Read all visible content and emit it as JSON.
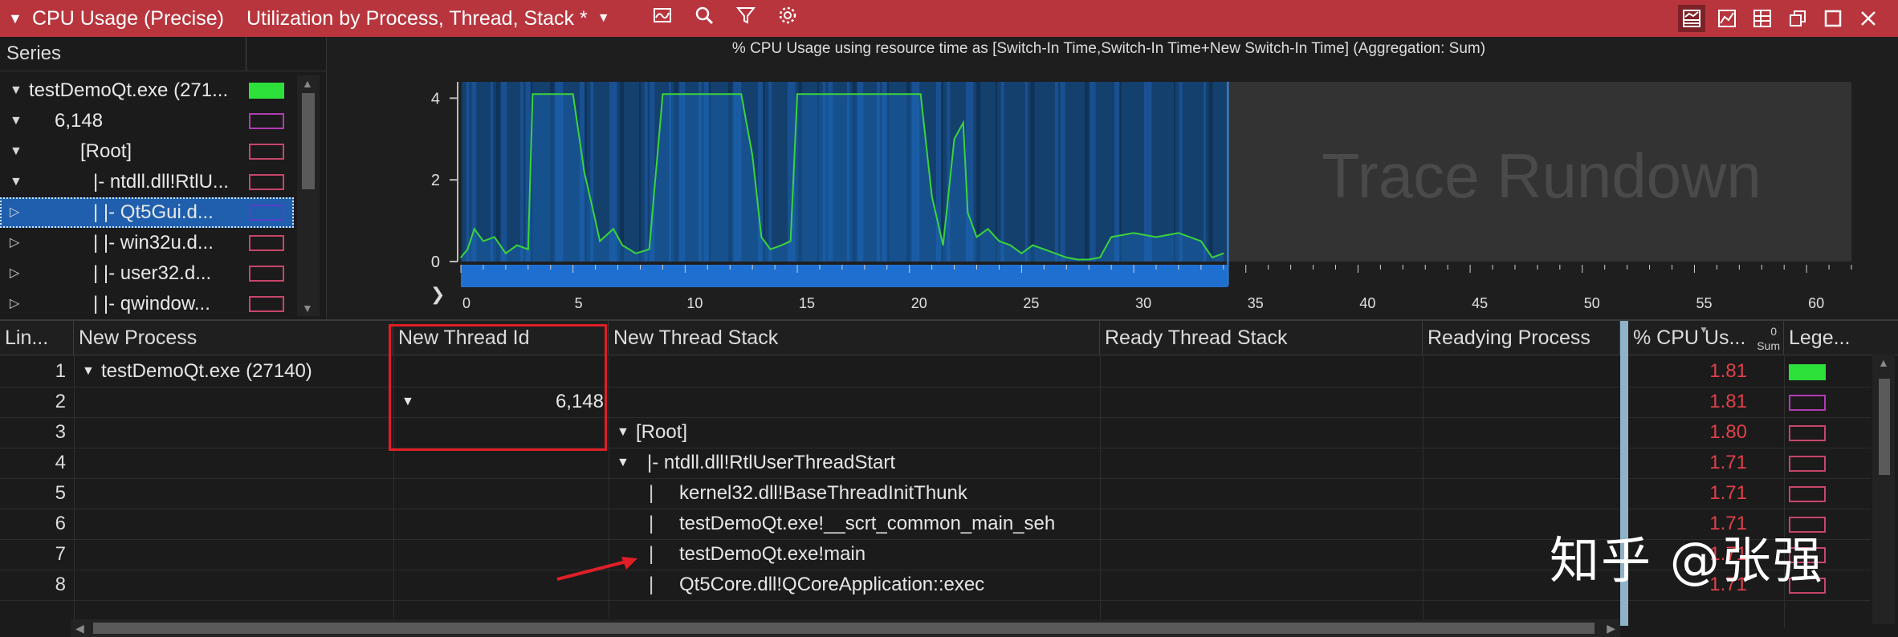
{
  "titlebar": {
    "title": "CPU Usage (Precise)",
    "view": "Utilization by Process, Thread, Stack *",
    "colors": {
      "bar": "#b8353d",
      "active_button": "#7b2127"
    }
  },
  "series_panel": {
    "header": "Series",
    "rows": [
      {
        "label": "testDemoQt.exe (271...",
        "swatch": "green"
      },
      {
        "label": "6,148",
        "swatch": "purple"
      },
      {
        "label": "[Root]",
        "swatch": "red"
      },
      {
        "label": "|- ntdll.dll!RtlU...",
        "swatch": "red"
      },
      {
        "label": "|  |- Qt5Gui.d...",
        "swatch": "red"
      },
      {
        "label": "|  |- win32u.d...",
        "swatch": "red"
      },
      {
        "label": "|  |- user32.d...",
        "swatch": "red"
      },
      {
        "label": "|  |- qwindow...",
        "swatch": "red"
      }
    ]
  },
  "chart": {
    "title": "% CPU Usage using resource time as [Switch-In Time,Switch-In Time+New Switch-In Time] (Aggregation: Sum)",
    "watermark": "Trace Rundown",
    "y_ticks": [
      "4",
      "2",
      "0"
    ],
    "x_ticks": [
      "0",
      "5",
      "10",
      "15",
      "20",
      "25",
      "30",
      "35",
      "40",
      "45",
      "50",
      "55",
      "60"
    ]
  },
  "chart_data": {
    "type": "area",
    "title": "% CPU Usage using resource time as [Switch-In Time,Switch-In Time+New Switch-In Time] (Aggregation: Sum)",
    "xlabel": "",
    "ylabel": "",
    "xlim": [
      0,
      62
    ],
    "ylim": [
      0,
      4.4
    ],
    "x_ticks": [
      0,
      5,
      10,
      15,
      20,
      25,
      30,
      35,
      40,
      45,
      50,
      55,
      60
    ],
    "y_ticks": [
      0,
      2,
      4
    ],
    "selected_range": [
      0,
      34.2
    ],
    "series": [
      {
        "color": "#3ad43a",
        "x": [
          0,
          0.3,
          0.6,
          1.0,
          1.5,
          2.0,
          2.5,
          3.0,
          3.2,
          3.6,
          4.0,
          4.5,
          5.0,
          5.5,
          6.0,
          6.2,
          6.8,
          7.2,
          7.8,
          8.4,
          8.7,
          9.0,
          9.5,
          10.0,
          11.0,
          12.0,
          12.5,
          13.0,
          13.4,
          13.8,
          14.3,
          14.7,
          15.0,
          15.5,
          17.0,
          19.0,
          20.0,
          20.5,
          21.0,
          21.5,
          22.0,
          22.4,
          22.6,
          23.0,
          23.5,
          24.0,
          24.5,
          25.0,
          25.5,
          26.0,
          26.5,
          27.0,
          27.5,
          28.0,
          28.5,
          29.0,
          30.0,
          31.0,
          32.0,
          33.0,
          33.5,
          34.0
        ],
        "values": [
          0.1,
          0.3,
          0.8,
          0.5,
          0.6,
          0.2,
          0.4,
          0.3,
          4.1,
          4.1,
          4.1,
          4.1,
          4.1,
          2.2,
          1.0,
          0.5,
          0.8,
          0.4,
          0.2,
          0.3,
          2.2,
          4.1,
          4.1,
          4.1,
          4.1,
          4.1,
          4.1,
          2.6,
          0.6,
          0.3,
          0.4,
          0.5,
          4.1,
          4.1,
          4.1,
          4.1,
          4.1,
          4.1,
          1.6,
          0.4,
          3.0,
          3.4,
          1.2,
          0.6,
          0.8,
          0.5,
          0.4,
          0.2,
          0.4,
          0.3,
          0.2,
          0.1,
          0.05,
          0.05,
          0.1,
          0.6,
          0.7,
          0.6,
          0.7,
          0.5,
          0.1,
          0.2
        ]
      }
    ]
  },
  "table": {
    "headers": [
      "Lin...",
      "New Process",
      "New Thread Id",
      "New Thread Stack",
      "Ready Thread Stack",
      "Readying Process",
      "% CPU Us...",
      "Lege..."
    ],
    "sum_label": "Sum",
    "sort_indicator": "0",
    "rows": [
      {
        "line": "1",
        "process": "testDemoQt.exe (27140)",
        "thread_id": "",
        "stack": "",
        "cpu": "1.81",
        "legend": "green"
      },
      {
        "line": "2",
        "process": "",
        "thread_id": "6,148",
        "stack": "",
        "cpu": "1.81",
        "legend": "purple"
      },
      {
        "line": "3",
        "process": "",
        "thread_id": "",
        "stack": "[Root]",
        "cpu": "1.80",
        "legend": "red"
      },
      {
        "line": "4",
        "process": "",
        "thread_id": "",
        "stack": "|- ntdll.dll!RtlUserThreadStart",
        "cpu": "1.71",
        "legend": "red"
      },
      {
        "line": "5",
        "process": "",
        "thread_id": "",
        "stack": "kernel32.dll!BaseThreadInitThunk",
        "cpu": "1.71",
        "legend": "red"
      },
      {
        "line": "6",
        "process": "",
        "thread_id": "",
        "stack": "testDemoQt.exe!__scrt_common_main_seh",
        "cpu": "1.71",
        "legend": "red"
      },
      {
        "line": "7",
        "process": "",
        "thread_id": "",
        "stack": "testDemoQt.exe!main",
        "cpu": "1.71",
        "legend": "red"
      },
      {
        "line": "8",
        "process": "",
        "thread_id": "",
        "stack": "Qt5Core.dll!QCoreApplication::exec",
        "cpu": "1.71",
        "legend": "red"
      }
    ]
  },
  "watermark": "知乎 @张强"
}
